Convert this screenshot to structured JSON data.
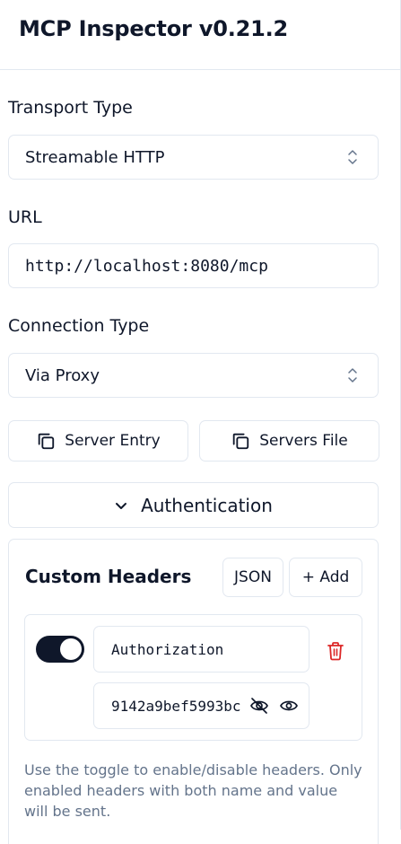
{
  "app": {
    "title": "MCP Inspector v0.21.2"
  },
  "transport": {
    "label": "Transport Type",
    "selected": "Streamable HTTP"
  },
  "url": {
    "label": "URL",
    "value": "http://localhost:8080/mcp"
  },
  "connection": {
    "label": "Connection Type",
    "selected": "Via Proxy"
  },
  "buttons": {
    "server_entry": "Server Entry",
    "servers_file": "Servers File",
    "authentication": "Authentication"
  },
  "custom_headers": {
    "title": "Custom Headers",
    "json_label": "JSON",
    "add_label": "+ Add",
    "headers": [
      {
        "enabled": true,
        "name": "Authorization",
        "value": "9142a9bef5993bc"
      }
    ],
    "hint": "Use the toggle to enable/disable headers. Only enabled headers with both name and value will be sent."
  },
  "colors": {
    "text": "#0f172a",
    "border": "#e2e8f0",
    "muted": "#64748b",
    "danger": "#dc2626"
  }
}
